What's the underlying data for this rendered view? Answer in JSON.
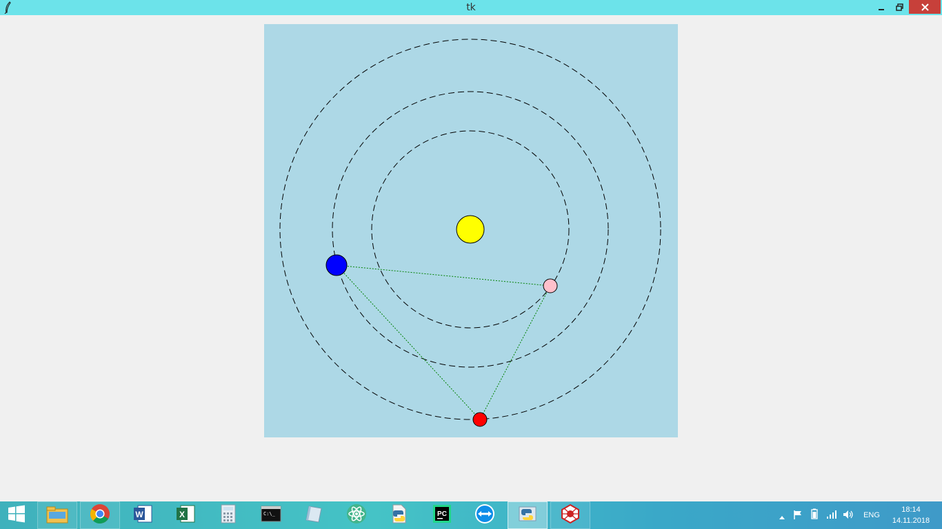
{
  "window": {
    "title": "tk",
    "icon": "feather-icon",
    "controls": [
      "minimize-icon",
      "restore-icon",
      "close-icon"
    ]
  },
  "canvas": {
    "background": "#add8e6",
    "sun_color": "#ffff00",
    "planet_colors": {
      "blue": "#0000ff",
      "pink": "#ffc0cb",
      "red": "#ff0000"
    },
    "orbit_color": "#000000",
    "connector_color": "#008000"
  },
  "taskbar": {
    "start_icon": "windows-logo-icon",
    "apps": [
      {
        "name": "file-explorer-icon"
      },
      {
        "name": "chrome-icon"
      },
      {
        "name": "word-icon"
      },
      {
        "name": "excel-icon"
      },
      {
        "name": "calculator-icon"
      },
      {
        "name": "command-prompt-icon"
      },
      {
        "name": "notepad-icon"
      },
      {
        "name": "atom-icon"
      },
      {
        "name": "python-file-icon"
      },
      {
        "name": "pycharm-icon"
      },
      {
        "name": "teamviewer-icon"
      },
      {
        "name": "python-icon"
      },
      {
        "name": "spider-icon"
      }
    ],
    "tray": {
      "language": "ENG",
      "time": "18:14",
      "date": "14.11.2018"
    }
  }
}
